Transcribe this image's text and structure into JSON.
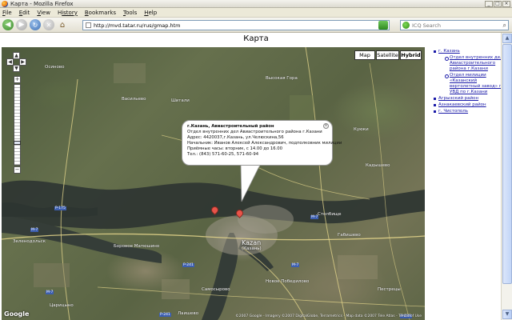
{
  "window": {
    "title": "Карта - Mozilla Firefox",
    "controls": [
      "_",
      "□",
      "×"
    ]
  },
  "menubar": [
    {
      "first": "F",
      "rest": "ile"
    },
    {
      "first": "E",
      "rest": "dit"
    },
    {
      "first": "V",
      "rest": "iew"
    },
    {
      "first": "H",
      "rest": "istory"
    },
    {
      "first": "B",
      "rest": "ookmarks"
    },
    {
      "first": "T",
      "rest": "ools"
    },
    {
      "first": "H",
      "rest": "elp"
    }
  ],
  "toolbar": {
    "url": "http://mvd.tatar.ru/rus/gmap.htm",
    "search_placeholder": "ICQ Search"
  },
  "page": {
    "title": "Карта"
  },
  "map": {
    "type_buttons": {
      "map": "Map",
      "satellite": "Satellite",
      "hybrid": "Hybrid",
      "selected": "Hybrid"
    },
    "infowindow": {
      "title": "г.Казань, Авиастроительный район",
      "lines": [
        "Отдел внутренних дел Авиастроительного района г.Казани",
        "Адрес: 4420037,г.Казань, ул.Челюскина,56",
        "Начальник: Иванов Алексей Александрович, подполковник милиции",
        "Приёмные часы: вторник, с 14.00 до 16.00",
        "Тел.: (843) 571-60-25, 571-60-94"
      ]
    },
    "city": {
      "name": "Kazan",
      "sub": "(Казань)"
    },
    "labels": [
      "Осиново",
      "Васильево",
      "Высокая Гора",
      "Куюки",
      "Боровое Матюшино",
      "Столбище",
      "Габишево",
      "Новое Победилово",
      "Пестрецы",
      "Зеленодольск",
      "Шигали",
      "Лаишево",
      "Кадышево",
      "Самосырово",
      "Царицыно"
    ],
    "roads": [
      "M-7",
      "M-7",
      "P-175",
      "P-239",
      "P-241",
      "M-7",
      "P-241",
      "M-7"
    ],
    "logo": "Google",
    "copyright": "©2007 Google - Imagery ©2007 DigitalGlobe, Terrametrics - Map data ©2007 Tele Atlas - Terms of Use"
  },
  "tree": {
    "items": [
      {
        "label": "г. Казань",
        "level": 0
      },
      {
        "label": "Отдел внутренних дел Авиастроительного района г.Казани",
        "level": 1
      },
      {
        "label": "Отдел милиции «Казанский вертолетный завод» при УВД по г.Казани",
        "level": 1
      },
      {
        "label": "Агрызский район",
        "level": 0
      },
      {
        "label": "Азнакаевский район",
        "level": 0
      },
      {
        "label": "г. Чистополь",
        "level": 0
      }
    ]
  }
}
